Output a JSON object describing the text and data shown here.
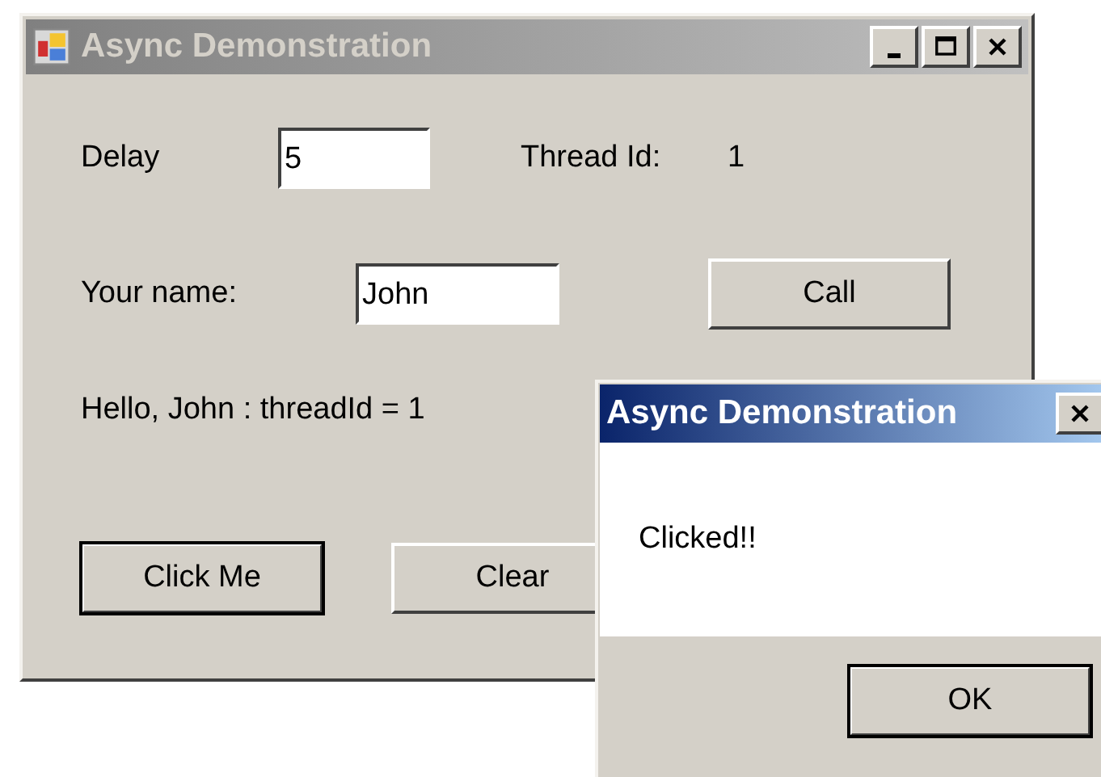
{
  "main_window": {
    "title": "Async Demonstration",
    "active": false,
    "delay": {
      "label": "Delay",
      "value": "5"
    },
    "thread": {
      "label": "Thread Id:",
      "value": "1"
    },
    "name": {
      "label": "Your name:",
      "value": "John"
    },
    "call_button": {
      "label": "Call",
      "default": false
    },
    "greeting": "Hello, John : threadId = 1",
    "buttons": [
      {
        "label": "Click Me",
        "default": true
      },
      {
        "label": "Clear",
        "default": false
      }
    ]
  },
  "message_box": {
    "title": "Async Demonstration",
    "active": true,
    "message": "Clicked!!",
    "button": {
      "label": "OK",
      "default": true
    }
  }
}
